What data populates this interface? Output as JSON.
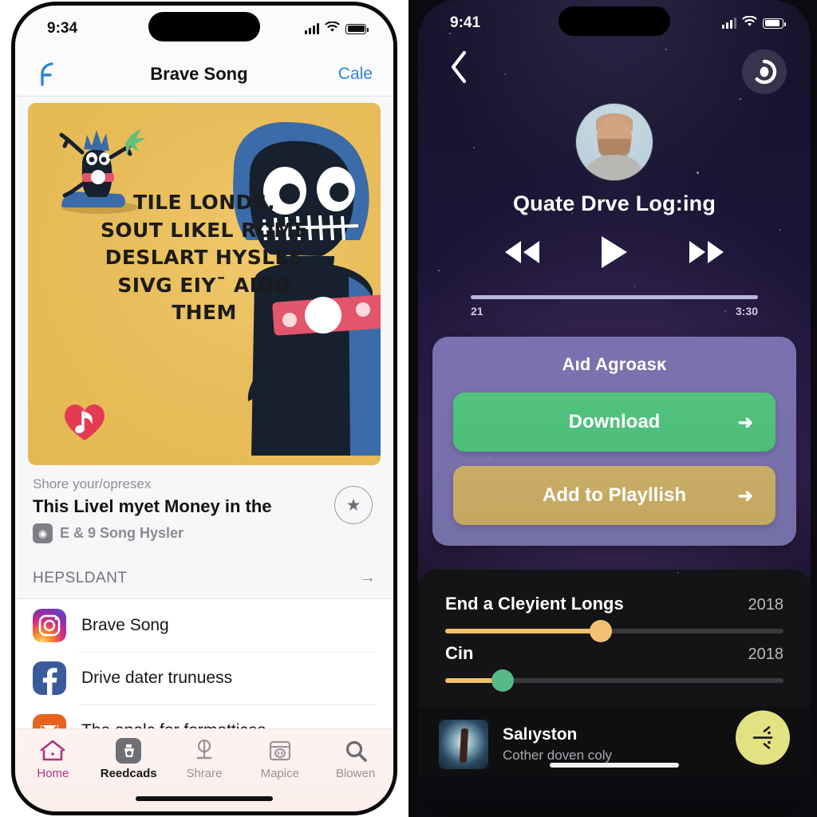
{
  "left_phone": {
    "status": {
      "time": "9:34",
      "signal_icon": "cellular-bars-icon",
      "wifi_icon": "wifi-icon",
      "battery_icon": "battery-icon"
    },
    "nav": {
      "back_icon": "back-arrow-icon",
      "title": "Brave Song",
      "action_label": "Cale"
    },
    "hero": {
      "quote_lines": [
        "TILE LONDS,",
        "SOUT LIKEL ROME",
        "DESLART HYSLES",
        "SIVG EIY¯ AIDD",
        "THEM"
      ],
      "mascot_icon": "blue-creature-mascot",
      "character_icon": "blue-monster-character",
      "heart_icon": "heart-music-note-icon"
    },
    "meta": {
      "kicker": "Shore your/opresex",
      "title": "This Livel myet Money in the",
      "chip_icon": "eye-badge-icon",
      "subtitle": "E & 9 Song Hysler",
      "star_icon": "star-icon"
    },
    "section": {
      "label": "HEPSLDANT",
      "arrow_icon": "chevron-right-icon"
    },
    "list": [
      {
        "icon": "instagram-icon",
        "label": "Brave Song"
      },
      {
        "icon": "facebook-icon",
        "label": "Drive dater trunuess"
      },
      {
        "icon": "mail-icon",
        "label": "The apolc for formottices"
      }
    ],
    "tabs": [
      {
        "icon": "home-icon",
        "label": "Home",
        "state": "active"
      },
      {
        "icon": "reeds-icon",
        "label": "Reedcads",
        "state": "selected"
      },
      {
        "icon": "microphone-icon",
        "label": "Shrare",
        "state": "normal"
      },
      {
        "icon": "map-icon",
        "label": "Mapice",
        "state": "normal"
      },
      {
        "icon": "search-icon",
        "label": "Blowen",
        "state": "normal"
      }
    ],
    "colors": {
      "accent_blue": "#2f84d6",
      "tab_active": "#b3307f",
      "hero_bg": "#e8bd5c"
    }
  },
  "right_phone": {
    "status": {
      "time": "9:41",
      "signal_icon": "cellular-bars-icon",
      "wifi_icon": "wifi-icon",
      "battery_icon": "battery-icon"
    },
    "nav": {
      "back_icon": "chevron-left-icon",
      "eye_icon": "camera-lens-icon"
    },
    "profile": {
      "avatar_icon": "user-avatar",
      "title": "Quate Drve Log:ing"
    },
    "player": {
      "rewind_icon": "rewind-icon",
      "play_icon": "play-icon",
      "forward_icon": "fast-forward-icon",
      "elapsed": "21",
      "duration": "3:30",
      "progress_percent": 100
    },
    "panel": {
      "title": "Aıd Agroasĸ",
      "buttons": [
        {
          "label": "Download",
          "arrow_icon": "arrow-right-icon",
          "color": "#4dbd79"
        },
        {
          "label": "Add to Playllish",
          "arrow_icon": "arrow-right-icon",
          "color": "#c4a860"
        }
      ]
    },
    "sliders": [
      {
        "name": "End a Cleyient Longs",
        "value": "2018",
        "percent": 46,
        "knob_color": "#f4c174"
      },
      {
        "name": "Cin",
        "value": "2018",
        "percent": 17,
        "knob_color": "#57b987"
      }
    ],
    "now_playing": {
      "art_icon": "album-art",
      "title": "Salıyston",
      "subtitle": "Cother doven coly",
      "fab_icon": "sparkle-icon"
    },
    "colors": {
      "panel_bg": "#7670a9",
      "green": "#4dbd79",
      "gold": "#c4a860",
      "fab": "#e2e283"
    }
  }
}
